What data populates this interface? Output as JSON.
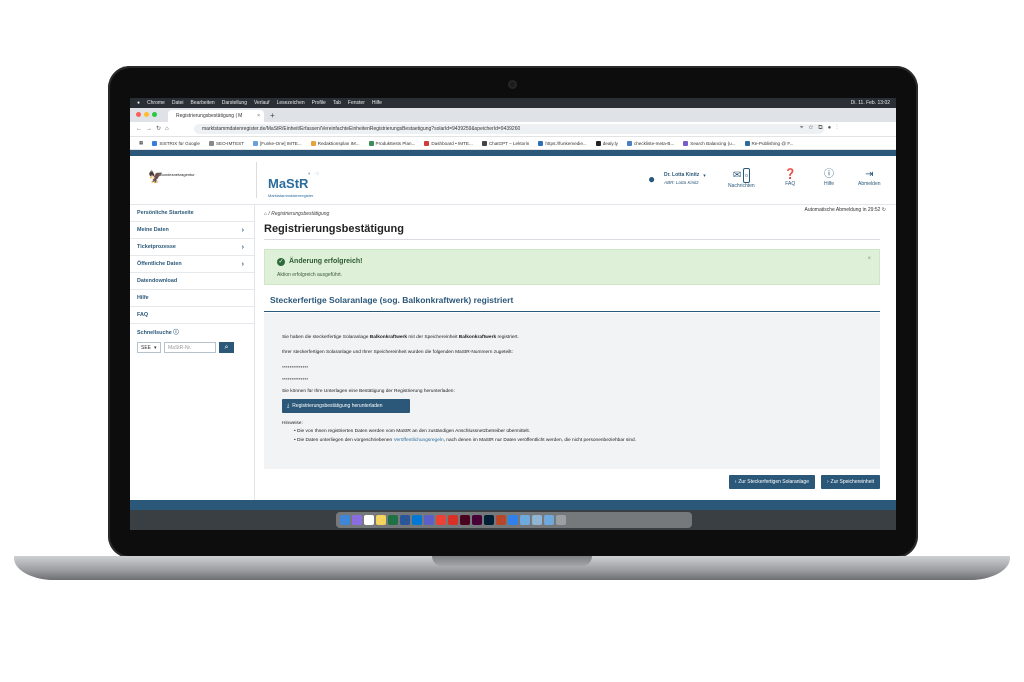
{
  "menubar": {
    "items": [
      "Chrome",
      "Datei",
      "Bearbeiten",
      "Darstellung",
      "Verlauf",
      "Lesezeichen",
      "Profile",
      "Tab",
      "Fenster",
      "Hilfe"
    ],
    "clock": "Di. 11. Feb. 13:02"
  },
  "browser": {
    "tab_title": "Registrierungsbestätigung | M",
    "url": "marktstammdatenregister.de/MaStR/Einheit/Erfassen/VereinfachteEinheitenRegistrierungsBestaetigung?solarId=9439259&speicherId=9439260",
    "bookmarks": [
      "SISTRIX für Google",
      "SEO-IMTEST",
      "[Funke-One] IMTE...",
      "Redaktionsplan IM...",
      "Produkttests Plan...",
      "Dashboard • IMTE...",
      "ChatGPT – Lektorin",
      "https://funkemedie...",
      "dealy.ly",
      "checkliste-meta-B...",
      "Search Balancing (u...",
      "Re-Publishing @ F..."
    ]
  },
  "header": {
    "org": "Bundesnetzagentur",
    "logo": "MaStR",
    "logo_sub": "Marktstammdatenregister",
    "user_name": "Dr. Lotta Kinitz",
    "user_role": "ABR: Lotta Kinitz",
    "nav": [
      {
        "label": "Nachrichten",
        "badge": "0"
      },
      {
        "label": "FAQ"
      },
      {
        "label": "Hilfe"
      },
      {
        "label": "Abmelden"
      }
    ]
  },
  "sidebar": {
    "items": [
      {
        "label": "Persönliche Startseite",
        "chev": ""
      },
      {
        "label": "Meine Daten",
        "chev": "›"
      },
      {
        "label": "Ticketprozesse",
        "chev": "›"
      },
      {
        "label": "Öffentliche Daten",
        "chev": "›"
      },
      {
        "label": "Datendownload",
        "chev": ""
      },
      {
        "label": "Hilfe",
        "chev": ""
      },
      {
        "label": "FAQ",
        "chev": ""
      }
    ],
    "quick_label": "Schnellsuche",
    "select_value": "SEE",
    "input_placeholder": "MaStR-Nr."
  },
  "main": {
    "breadcrumb": "Registrierungsbestätigung",
    "auto_logout": "Automatische Abmeldung in 29:52",
    "title": "Registrierungsbestätigung",
    "alert_head": "Änderung erfolgreich!",
    "alert_body": "Aktion erfolgreich ausgeführt.",
    "section_title": "Steckerfertige Solaranlage (sog. Balkonkraftwerk) registriert",
    "p1_pre": "Sie haben die steckerfertige Solaranlage ",
    "p1_b1": "Balkonkraftwerk",
    "p1_mid": " mit der Speichereinheit ",
    "p1_b2": "Balkonkraftwerk",
    "p1_post": " registriert.",
    "p2": "Ihrer steckerfertigen Solaranlage und Ihrer Speichereinheit wurden die folgenden MaStR-Nummern zugeteilt:",
    "n1": "**************",
    "n2": "**************",
    "p3": "Sie können für Ihre Unterlagen eine Bestätigung der Registrierung herunterladen:",
    "download": "Registrierungsbestätigung herunterladen",
    "hint": "Hinweise:",
    "bullet1": "Die von Ihnen registrierten Daten werden vom MaStR an den zuständigen Anschlussnetzbetreiber übermittelt.",
    "bullet2_pre": "Die Daten unterliegen den vorgeschriebenen ",
    "bullet2_link": "Veröffentlichungsregeln",
    "bullet2_post": ", nach denen im MaStR nur Daten veröffentlicht werden, die nicht personenbeziehbar sind.",
    "btn_solar": "Zur Steckerfertigen Solaranlage",
    "btn_speicher": "Zur Speichereinheit"
  }
}
